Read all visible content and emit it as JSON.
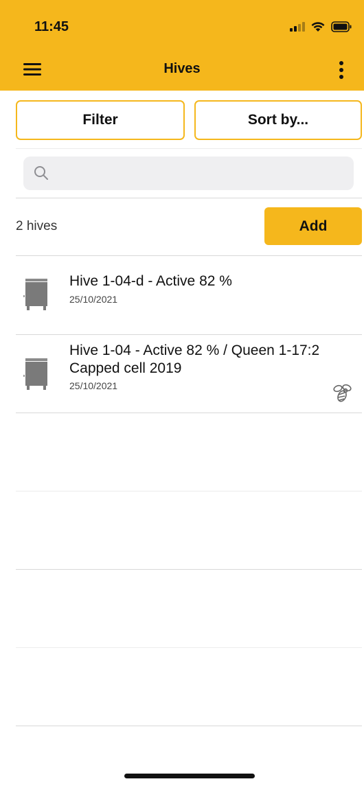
{
  "status_bar": {
    "time": "11:45"
  },
  "toolbar": {
    "title": "Hives",
    "menu_icon": "hamburger-menu-icon",
    "more_icon": "vertical-ellipsis-icon"
  },
  "controls": {
    "filter_label": "Filter",
    "sort_label": "Sort by..."
  },
  "search": {
    "value": "",
    "placeholder": ""
  },
  "summary": {
    "count_text": "2 hives",
    "add_label": "Add"
  },
  "hives": [
    {
      "title": "Hive 1-04-d - Active 82 %",
      "date": "25/10/2021",
      "has_queen": false
    },
    {
      "title": "Hive 1-04 - Active 82 %  / Queen 1-17:2 Capped cell 2019",
      "date": "25/10/2021",
      "has_queen": true
    }
  ],
  "colors": {
    "accent": "#f5b71c",
    "icon_gray": "#7a7a7a",
    "divider": "#d8d8d8",
    "search_bg": "#efeff1"
  }
}
